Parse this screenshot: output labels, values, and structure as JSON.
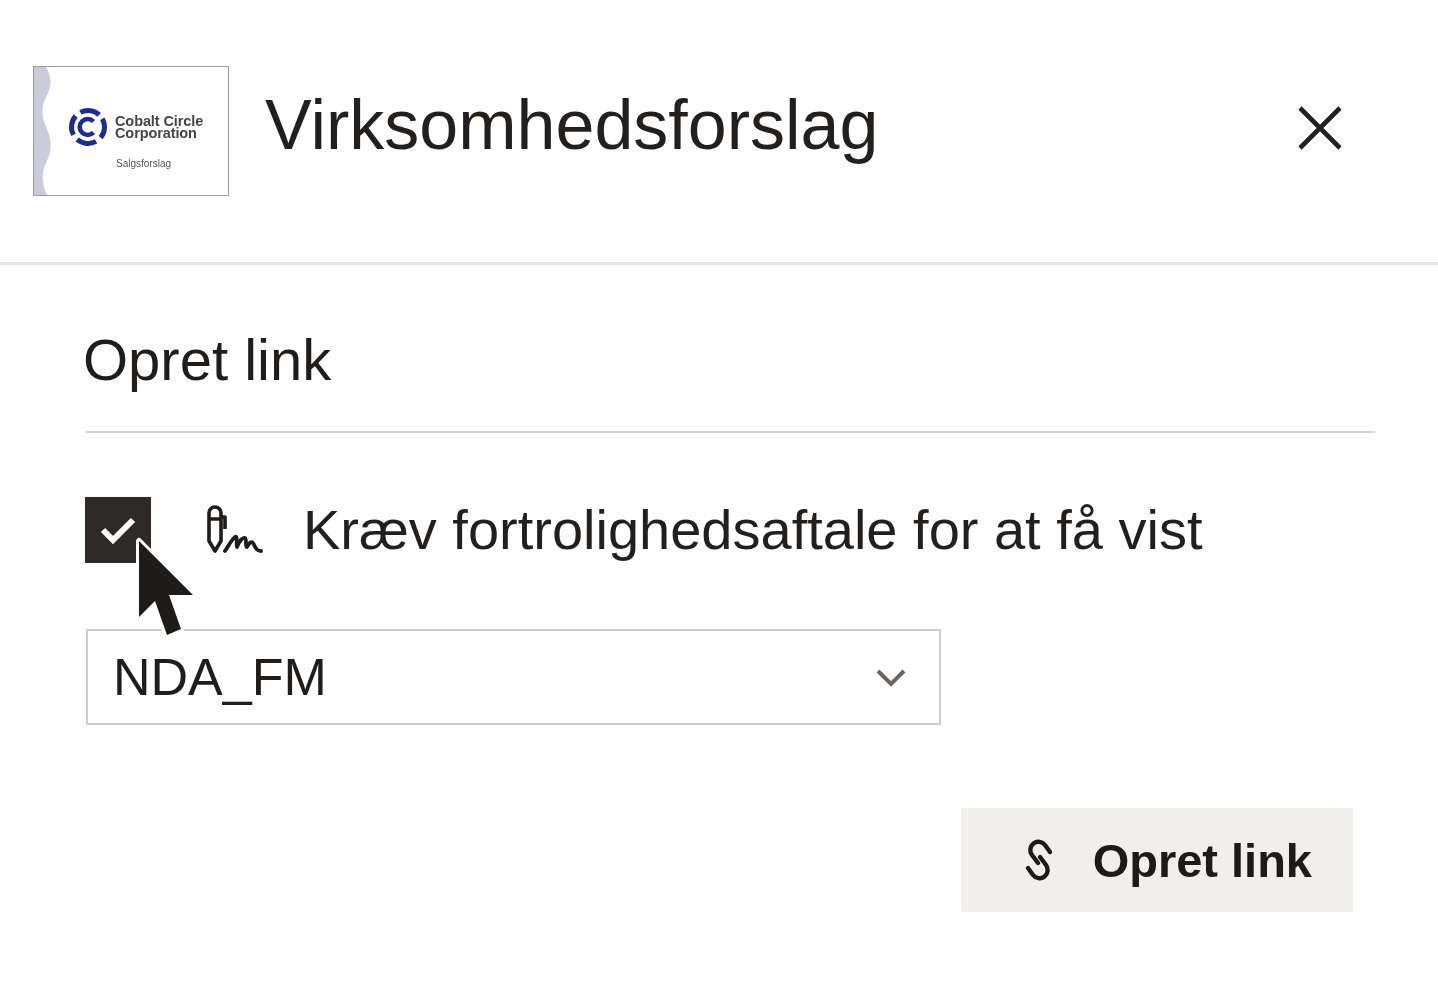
{
  "header": {
    "thumbnail": {
      "company": "Cobalt Circle Corporation",
      "caption": "Salgsforslag"
    },
    "title": "Virksomhedsforslag"
  },
  "section": {
    "title": "Opret link",
    "nda_option": {
      "checked": true,
      "label": "Kræv fortrolighedsaftale for at få vist"
    },
    "nda_select": {
      "value": "NDA_FM"
    },
    "button": {
      "label": "Opret link"
    }
  }
}
